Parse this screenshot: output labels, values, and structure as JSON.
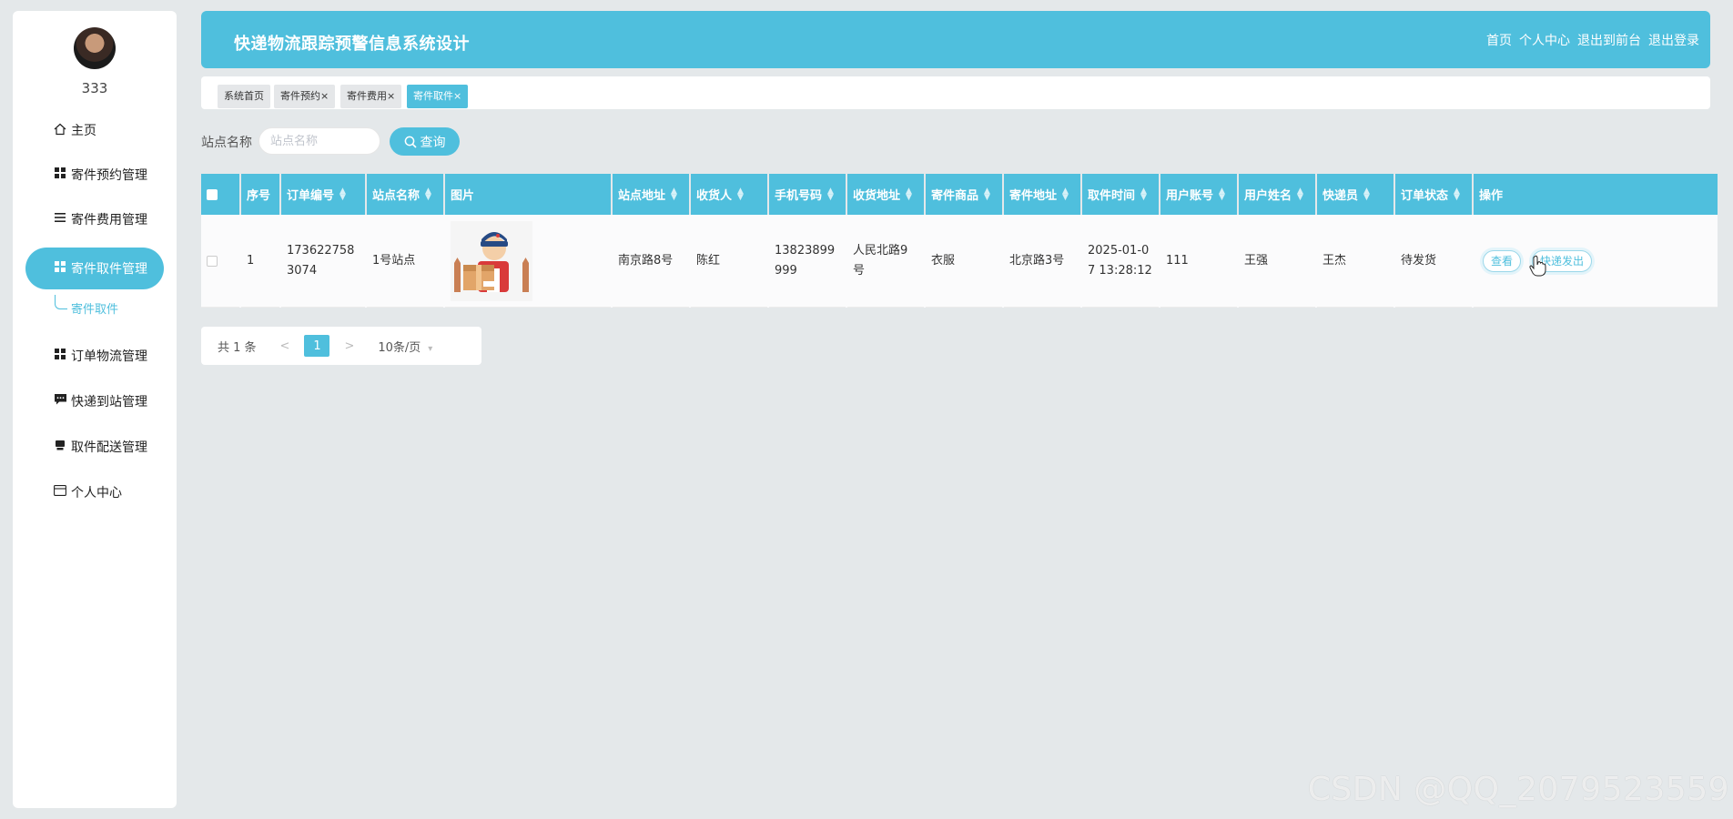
{
  "sidebar": {
    "username": "333",
    "items": [
      {
        "label": "主页",
        "icon": "home-icon"
      },
      {
        "label": "寄件预约管理",
        "icon": "grid-icon"
      },
      {
        "label": "寄件费用管理",
        "icon": "list-icon"
      },
      {
        "label": "寄件取件管理",
        "icon": "grid-icon",
        "active": true
      },
      {
        "label": "订单物流管理",
        "icon": "grid-icon"
      },
      {
        "label": "快递到站管理",
        "icon": "chat-icon"
      },
      {
        "label": "取件配送管理",
        "icon": "printer-icon"
      },
      {
        "label": "个人中心",
        "icon": "card-icon"
      }
    ],
    "sub_item": "寄件取件"
  },
  "header": {
    "title": "快递物流跟踪预警信息系统设计",
    "nav": [
      "首页",
      "个人中心",
      "退出到前台",
      "退出登录"
    ]
  },
  "tabs": [
    {
      "label": "系统首页",
      "closable": false
    },
    {
      "label": "寄件预约",
      "closable": true
    },
    {
      "label": "寄件费用",
      "closable": true
    },
    {
      "label": "寄件取件",
      "closable": true,
      "active": true
    }
  ],
  "search": {
    "label": "站点名称",
    "placeholder": "站点名称",
    "button": "查询"
  },
  "table": {
    "columns": [
      "序号",
      "订单编号",
      "站点名称",
      "图片",
      "站点地址",
      "收货人",
      "手机号码",
      "收货地址",
      "寄件商品",
      "寄件地址",
      "取件时间",
      "用户账号",
      "用户姓名",
      "快递员",
      "订单状态",
      "操作"
    ],
    "rows": [
      {
        "index": "1",
        "order_no": "1736227583074",
        "station": "1号站点",
        "station_addr": "南京路8号",
        "receiver": "陈红",
        "phone": "13823899999",
        "receive_addr": "人民北路9号",
        "goods": "衣服",
        "send_addr": "北京路3号",
        "pickup_time": "2025-01-07 13:28:12",
        "account": "111",
        "user_name": "王强",
        "courier": "王杰",
        "status": "待发货",
        "actions": [
          "查看",
          "快递发出"
        ]
      }
    ]
  },
  "pagination": {
    "total": "共 1 条",
    "prev": "<",
    "page": "1",
    "next": ">",
    "page_size": "10条/页"
  },
  "watermark": "CSDN @QQ_2079523559",
  "colors": {
    "accent": "#4fbfdd",
    "background": "#e4e8ea"
  }
}
